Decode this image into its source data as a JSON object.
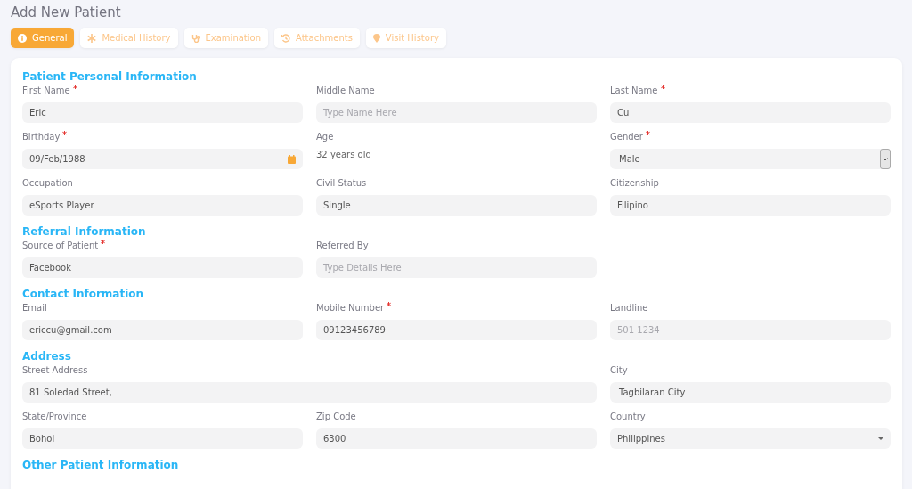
{
  "page": {
    "title": "Add New Patient"
  },
  "tabs": [
    {
      "label": "General",
      "selected": true
    },
    {
      "label": "Medical History",
      "selected": false
    },
    {
      "label": "Examination",
      "selected": false
    },
    {
      "label": "Attachments",
      "selected": false
    },
    {
      "label": "Visit History",
      "selected": false
    }
  ],
  "sections": [
    {
      "title": "Patient Personal Information",
      "rows": [
        [
          {
            "label": "First Name",
            "required": true,
            "kind": "text",
            "value": "Eric"
          },
          {
            "label": "Middle Name",
            "required": false,
            "kind": "text",
            "placeholder": "Type Name Here"
          },
          {
            "label": "Last Name",
            "required": true,
            "kind": "text",
            "value": "Cu"
          }
        ],
        [
          {
            "label": "Birthday",
            "required": true,
            "kind": "date",
            "value": "09/Feb/1988"
          },
          {
            "label": "Age",
            "required": false,
            "kind": "static",
            "value": "32 years old"
          },
          {
            "label": "Gender",
            "required": true,
            "kind": "select",
            "value": "Male"
          }
        ],
        [
          {
            "label": "Occupation",
            "required": false,
            "kind": "text",
            "value": "eSports Player"
          },
          {
            "label": "Civil Status",
            "required": false,
            "kind": "text",
            "value": "Single"
          },
          {
            "label": "Citizenship",
            "required": false,
            "kind": "text",
            "value": "Filipino"
          }
        ]
      ]
    },
    {
      "title": "Referral Information",
      "rows": [
        [
          {
            "label": "Source of Patient",
            "required": true,
            "kind": "text",
            "value": "Facebook"
          },
          {
            "label": "Referred By",
            "required": false,
            "kind": "text",
            "placeholder": "Type Details Here"
          }
        ]
      ]
    },
    {
      "title": "Contact Information",
      "rows": [
        [
          {
            "label": "Email",
            "required": false,
            "kind": "text",
            "value": "ericcu@gmail.com"
          },
          {
            "label": "Mobile Number",
            "required": true,
            "kind": "text",
            "value": "09123456789"
          },
          {
            "label": "Landline",
            "required": false,
            "kind": "text",
            "placeholder": "501 1234"
          }
        ]
      ]
    },
    {
      "title": "Address",
      "rows": [
        [
          {
            "label": "Street Address",
            "required": false,
            "kind": "wide",
            "value": "81 Soledad Street,"
          },
          "",
          {
            "label": "City",
            "required": false,
            "kind": "picker",
            "value": "Tagbilaran City"
          }
        ],
        [
          {
            "label": "State/Province",
            "required": false,
            "kind": "text",
            "value": "Bohol"
          },
          {
            "label": "Zip Code",
            "required": false,
            "kind": "text",
            "value": "6300"
          },
          {
            "label": "Country",
            "required": false,
            "kind": "dropdown",
            "value": "Philippines"
          }
        ]
      ]
    },
    {
      "title": "Other Patient Information"
    }
  ]
}
